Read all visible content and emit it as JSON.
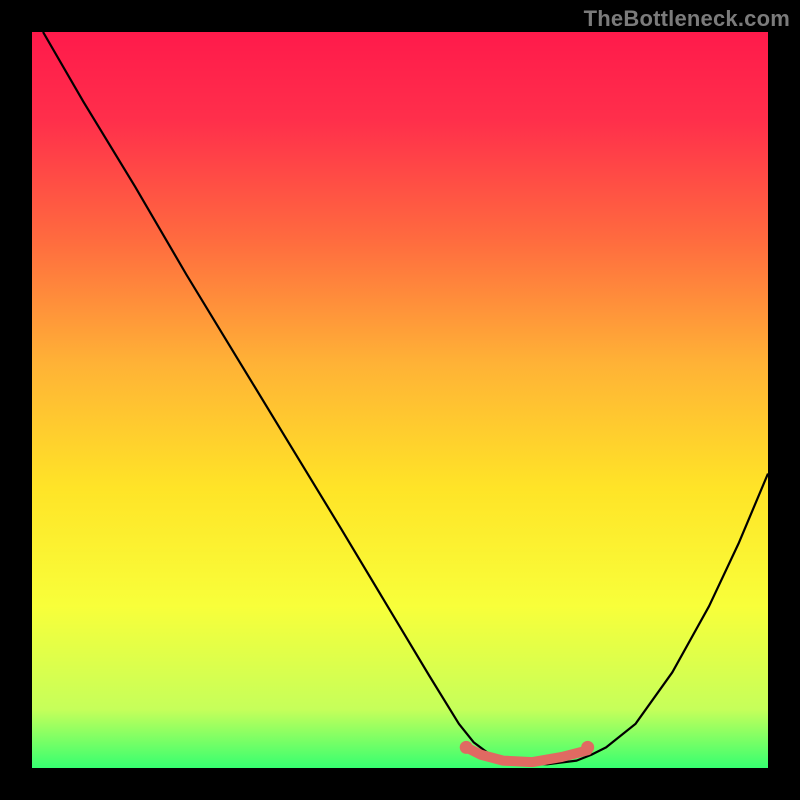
{
  "watermark": "TheBottleneck.com",
  "chart_data": {
    "type": "line",
    "title": "",
    "xlabel": "",
    "ylabel": "",
    "xlim": [
      0,
      1
    ],
    "ylim": [
      0,
      1
    ],
    "background_gradient": {
      "stops": [
        {
          "offset": 0.0,
          "color": "#ff1a4b"
        },
        {
          "offset": 0.12,
          "color": "#ff2f4b"
        },
        {
          "offset": 0.28,
          "color": "#ff6a3f"
        },
        {
          "offset": 0.45,
          "color": "#ffb236"
        },
        {
          "offset": 0.62,
          "color": "#ffe427"
        },
        {
          "offset": 0.78,
          "color": "#f8ff3a"
        },
        {
          "offset": 0.92,
          "color": "#c6ff5a"
        },
        {
          "offset": 1.0,
          "color": "#36ff70"
        }
      ]
    },
    "series": [
      {
        "name": "bottleneck-curve",
        "color": "#000000",
        "stroke_width": 2.2,
        "x": [
          0.015,
          0.07,
          0.14,
          0.21,
          0.28,
          0.35,
          0.42,
          0.48,
          0.54,
          0.58,
          0.6,
          0.62,
          0.66,
          0.7,
          0.74,
          0.76,
          0.78,
          0.82,
          0.87,
          0.92,
          0.96,
          1.0
        ],
        "y": [
          1.0,
          0.905,
          0.79,
          0.67,
          0.555,
          0.44,
          0.325,
          0.225,
          0.125,
          0.06,
          0.035,
          0.02,
          0.007,
          0.005,
          0.01,
          0.018,
          0.028,
          0.06,
          0.13,
          0.22,
          0.305,
          0.4
        ]
      },
      {
        "name": "flat-region-marker",
        "color": "#e06a62",
        "stroke_width": 10,
        "linecap": "round",
        "x": [
          0.59,
          0.61,
          0.64,
          0.68,
          0.72,
          0.755
        ],
        "y": [
          0.028,
          0.018,
          0.01,
          0.008,
          0.015,
          0.024
        ]
      }
    ],
    "points": [
      {
        "name": "flat-start-point",
        "x": 0.59,
        "y": 0.028,
        "r": 6.5,
        "color": "#e06a62"
      },
      {
        "name": "flat-end-point",
        "x": 0.755,
        "y": 0.028,
        "r": 6.5,
        "color": "#e06a62"
      }
    ]
  }
}
